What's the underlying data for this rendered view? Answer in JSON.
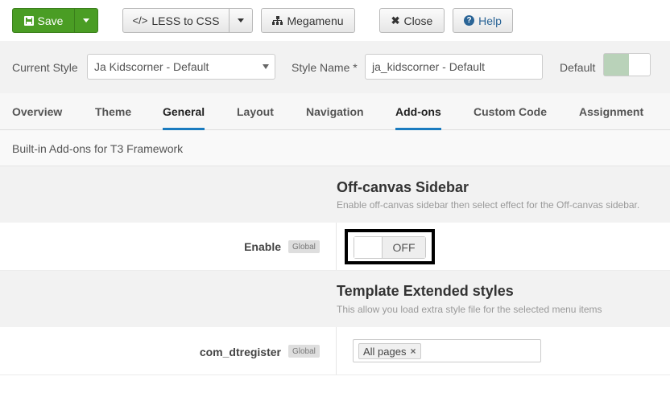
{
  "toolbar": {
    "save_label": "Save",
    "less_label": "LESS to CSS",
    "megamenu_label": "Megamenu",
    "close_label": "Close",
    "help_label": "Help",
    "colors": {
      "save_bg": "#4a9d24",
      "help_text": "#2a6496"
    }
  },
  "style_bar": {
    "current_style_label": "Current Style",
    "current_style_value": "Ja Kidscorner - Default",
    "style_name_label": "Style Name *",
    "style_name_value": "ja_kidscorner - Default",
    "default_label": "Default",
    "default_on": true
  },
  "tabs": [
    {
      "label": "Overview",
      "active": false
    },
    {
      "label": "Theme",
      "active": false
    },
    {
      "label": "General",
      "active": true
    },
    {
      "label": "Layout",
      "active": false
    },
    {
      "label": "Navigation",
      "active": false
    },
    {
      "label": "Add-ons",
      "active": true
    },
    {
      "label": "Custom Code",
      "active": false
    },
    {
      "label": "Assignment",
      "active": false
    }
  ],
  "description": "Built-in Add-ons for T3 Framework",
  "sections": [
    {
      "title": "Off-canvas Sidebar",
      "subtitle": "Enable off-canvas sidebar then select effect for the Off-canvas sidebar.",
      "field_label": "Enable",
      "badge": "Global",
      "toggle_value": "OFF"
    },
    {
      "title": "Template Extended styles",
      "subtitle": "This allow you load extra style file for the selected menu items",
      "field_label": "com_dtregister",
      "badge": "Global",
      "tag": "All pages",
      "tag_remove": "×"
    }
  ],
  "accent_color": "#1a7bbf"
}
